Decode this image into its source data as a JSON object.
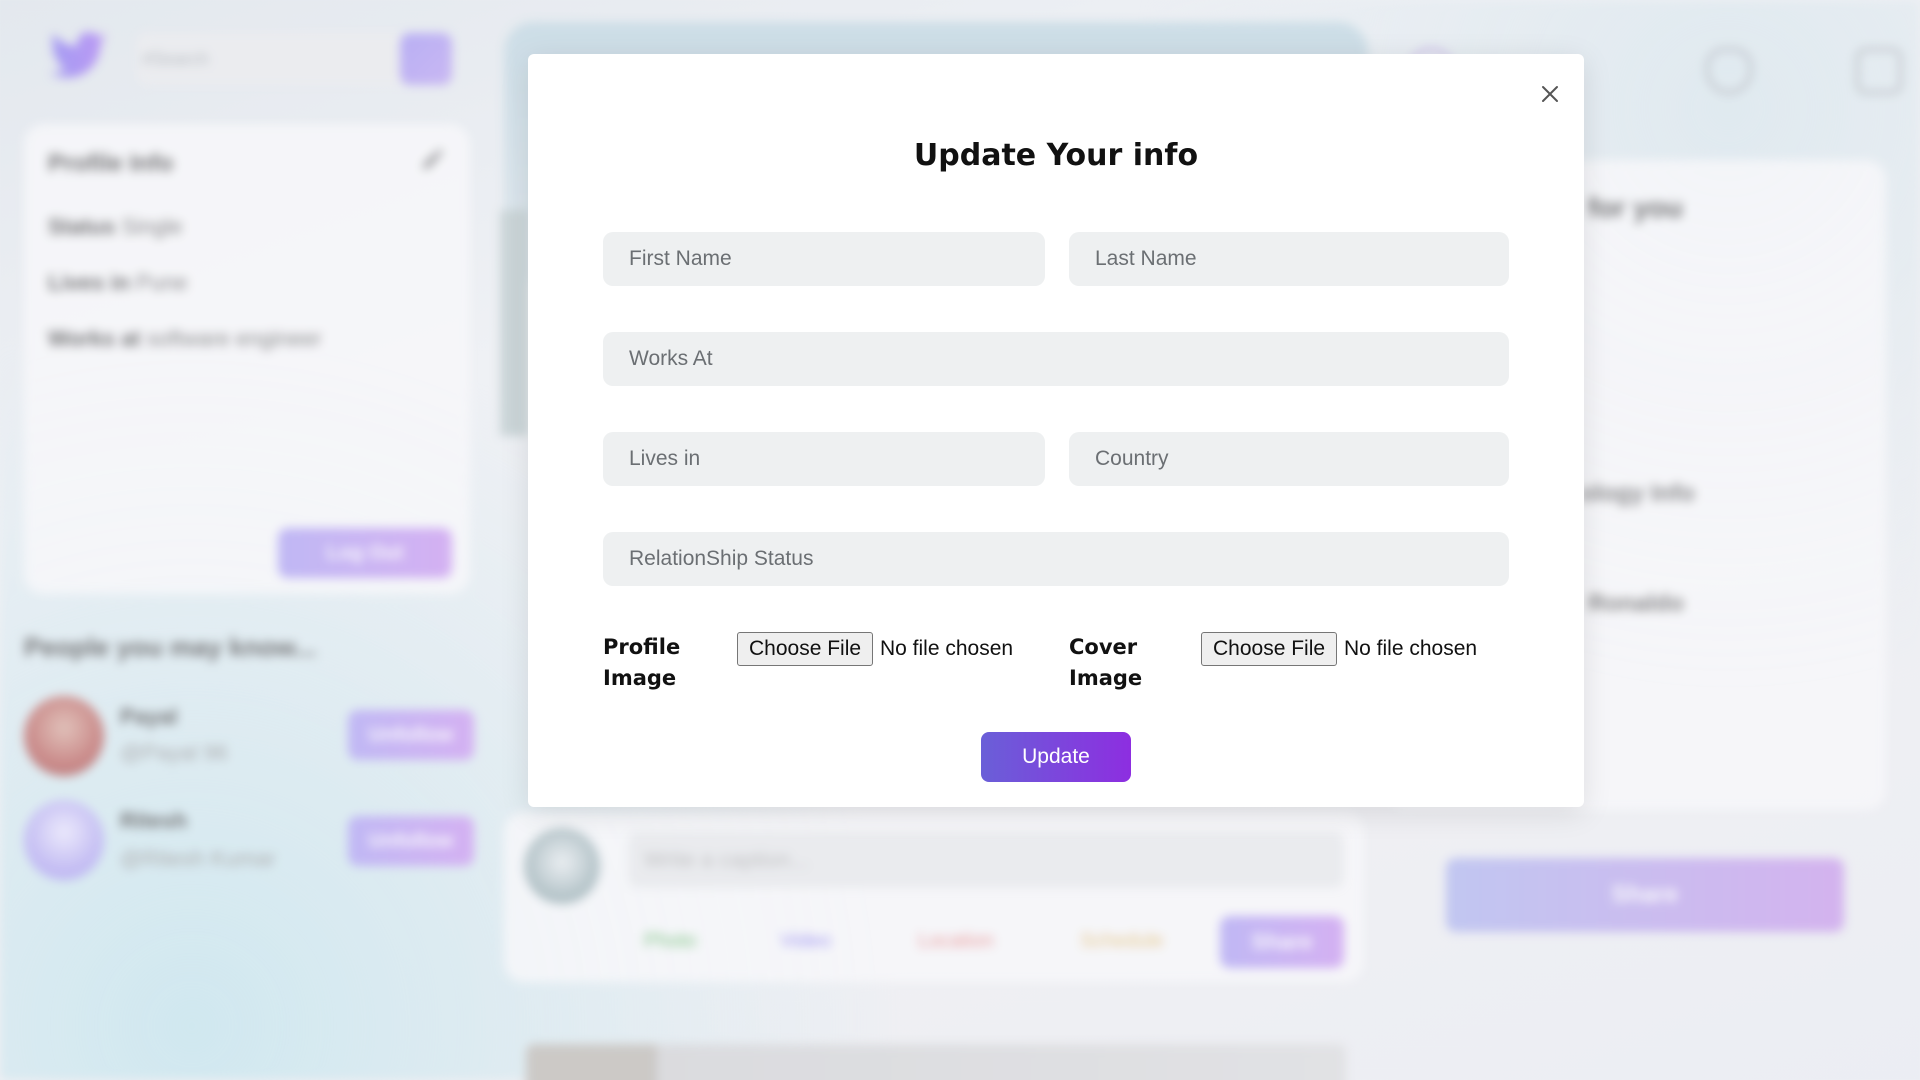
{
  "background": {
    "search_placeholder": "#Search",
    "profile_card": {
      "title": "Profile Info",
      "status_label": "Status",
      "status_value": "Single",
      "lives_label": "Lives in",
      "lives_value": "Pune",
      "works_label": "Works at",
      "works_value": "software engineer",
      "logout_label": "Log Out"
    },
    "people_heading": "People you may know...",
    "people": [
      {
        "name": "Payal",
        "handle": "@Payal 96",
        "action": "Unfollow"
      },
      {
        "name": "Ritesh",
        "handle": "@Ritesh Kumar",
        "action": "Unfollow"
      }
    ],
    "trends_fragments": [
      "for you",
      "ology Info",
      "Ronaldo"
    ],
    "caption_placeholder": "Write a caption...",
    "options": [
      "Photo",
      "Video",
      "Location",
      "Schedule"
    ],
    "share_label": "Share",
    "right_share_label": "Share"
  },
  "modal": {
    "title": "Update Your info",
    "fields": {
      "first_name": {
        "placeholder": "First Name",
        "value": ""
      },
      "last_name": {
        "placeholder": "Last Name",
        "value": ""
      },
      "works_at": {
        "placeholder": "Works At",
        "value": ""
      },
      "lives_in": {
        "placeholder": "Lives in",
        "value": ""
      },
      "country": {
        "placeholder": "Country",
        "value": ""
      },
      "relationship": {
        "placeholder": "RelationShip Status",
        "value": ""
      }
    },
    "profile_image_label_1": "Profile",
    "profile_image_label_2": "Image",
    "cover_image_label_1": "Cover",
    "cover_image_label_2": "Image",
    "choose_file_label": "Choose File",
    "no_file_text": "No file chosen",
    "update_label": "Update"
  },
  "colors": {
    "accent_start": "#6a5fd8",
    "accent_end": "#8d2ee0",
    "field_bg": "#eef0f1"
  },
  "icons": [
    "twitter-logo-icon",
    "search-icon",
    "pencil-icon",
    "notification-icon",
    "comment-icon",
    "close-icon"
  ]
}
